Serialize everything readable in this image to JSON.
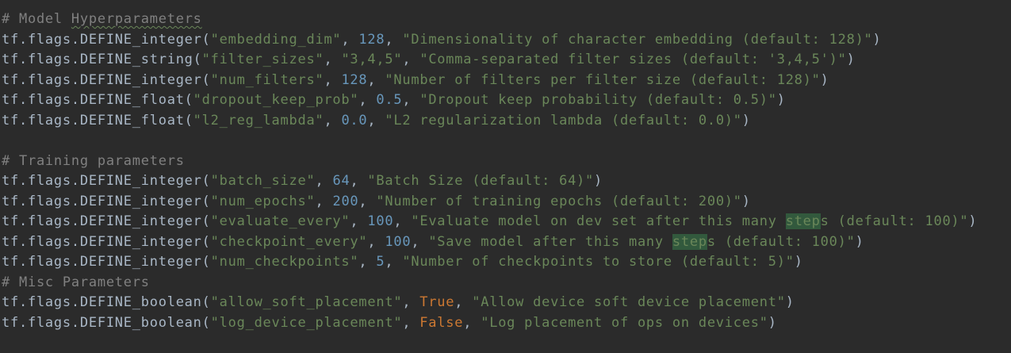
{
  "lines": [
    {
      "type": "comment",
      "prefix": "# Model ",
      "squiggle": "Hyperparameters"
    },
    {
      "type": "call",
      "func": "tf.flags.DEFINE_integer(",
      "name": "\"embedding_dim\"",
      "sep1": ", ",
      "value": "128",
      "valueKind": "num",
      "sep2": ", ",
      "desc": "\"Dimensionality of character embedding (default: 128)\"",
      "close": ")"
    },
    {
      "type": "call",
      "func": "tf.flags.DEFINE_string(",
      "name": "\"filter_sizes\"",
      "sep1": ", ",
      "value": "\"3,4,5\"",
      "valueKind": "str",
      "sep2": ", ",
      "desc": "\"Comma-separated filter sizes (default: '3,4,5')\"",
      "close": ")"
    },
    {
      "type": "call",
      "func": "tf.flags.DEFINE_integer(",
      "name": "\"num_filters\"",
      "sep1": ", ",
      "value": "128",
      "valueKind": "num",
      "sep2": ", ",
      "desc": "\"Number of filters per filter size (default: 128)\"",
      "close": ")"
    },
    {
      "type": "call",
      "func": "tf.flags.DEFINE_float(",
      "name": "\"dropout_keep_prob\"",
      "sep1": ", ",
      "value": "0.5",
      "valueKind": "num",
      "sep2": ", ",
      "desc": "\"Dropout keep probability (default: 0.5)\"",
      "close": ")"
    },
    {
      "type": "call",
      "func": "tf.flags.DEFINE_float(",
      "name": "\"l2_reg_lambda\"",
      "sep1": ", ",
      "value": "0.0",
      "valueKind": "num",
      "sep2": ", ",
      "desc": "\"L2 regularization lambda (default: 0.0)\"",
      "close": ")"
    },
    {
      "type": "blank"
    },
    {
      "type": "comment",
      "prefix": "# Training parameters"
    },
    {
      "type": "call",
      "func": "tf.flags.DEFINE_integer(",
      "name": "\"batch_size\"",
      "sep1": ", ",
      "value": "64",
      "valueKind": "num",
      "sep2": ", ",
      "desc": "\"Batch Size (default: 64)\"",
      "close": ")"
    },
    {
      "type": "call",
      "func": "tf.flags.DEFINE_integer(",
      "name": "\"num_epochs\"",
      "sep1": ", ",
      "value": "200",
      "valueKind": "num",
      "sep2": ", ",
      "desc": "\"Number of training epochs (default: 200)\"",
      "close": ")"
    },
    {
      "type": "call",
      "func": "tf.flags.DEFINE_integer(",
      "name": "\"evaluate_every\"",
      "sep1": ", ",
      "value": "100",
      "valueKind": "num",
      "sep2": ", ",
      "desc": "\"Evaluate model on dev set after this many ",
      "hl": "step",
      "descRest": "s (default: 100)\"",
      "close": ")"
    },
    {
      "type": "call",
      "func": "tf.flags.DEFINE_integer(",
      "name": "\"checkpoint_every\"",
      "sep1": ", ",
      "value": "100",
      "valueKind": "num",
      "sep2": ", ",
      "desc": "\"Save model after this many ",
      "hl": "step",
      "descRest": "s (default: 100)\"",
      "close": ")"
    },
    {
      "type": "call",
      "func": "tf.flags.DEFINE_integer(",
      "name": "\"num_checkpoints\"",
      "sep1": ", ",
      "value": "5",
      "valueKind": "num",
      "sep2": ", ",
      "desc": "\"Number of checkpoints to store (default: 5)\"",
      "close": ")"
    },
    {
      "type": "comment",
      "prefix": "# Misc Parameters"
    },
    {
      "type": "call",
      "func": "tf.flags.DEFINE_boolean(",
      "name": "\"allow_soft_placement\"",
      "sep1": ", ",
      "value": "True",
      "valueKind": "kw",
      "sep2": ", ",
      "desc": "\"Allow device soft device placement\"",
      "close": ")"
    },
    {
      "type": "call",
      "func": "tf.flags.DEFINE_boolean(",
      "name": "\"log_device_placement\"",
      "sep1": ", ",
      "value": "False",
      "valueKind": "kw",
      "sep2": ", ",
      "desc": "\"Log placement of ops on devices\"",
      "close": ")"
    }
  ],
  "colors": {
    "background": "#2b2b2b",
    "text": "#a9b7c6",
    "comment": "#808080",
    "string": "#6a8759",
    "number": "#6897bb",
    "keyword": "#cc7832",
    "highlight": "#32593d"
  }
}
